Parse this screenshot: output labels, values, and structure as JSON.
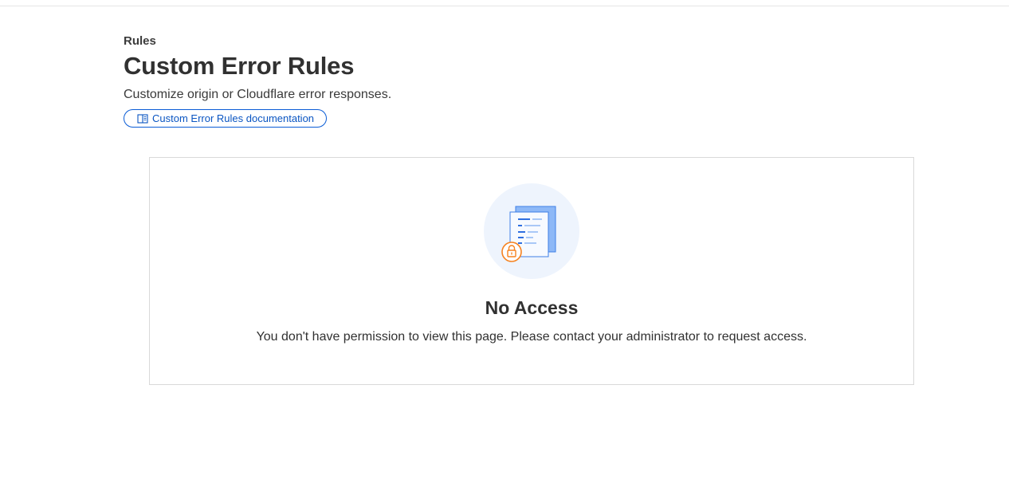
{
  "header": {
    "breadcrumb": "Rules",
    "title": "Custom Error Rules",
    "description": "Customize origin or Cloudflare error responses.",
    "doc_link": {
      "label": "Custom Error Rules documentation",
      "icon": "book-icon"
    }
  },
  "empty_state": {
    "illustration_icon": "locked-document-icon",
    "title": "No Access",
    "message": "You don't have permission to view this page. Please contact your administrator to request access."
  },
  "colors": {
    "link_blue": "#0a55c2",
    "illustration_circle": "#eef4fd",
    "doc_blue": "#5b97f2",
    "lock_orange": "#f6821f"
  }
}
